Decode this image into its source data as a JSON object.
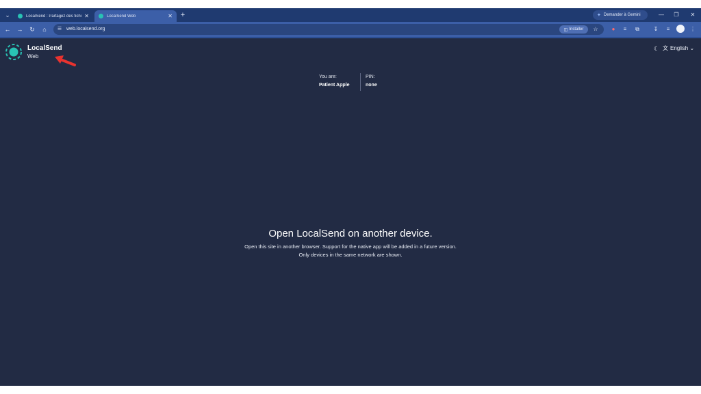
{
  "browser": {
    "tabs": [
      {
        "title": "LocalSend : Partagez des fichier",
        "active": false
      },
      {
        "title": "LocalSend Web",
        "active": true
      }
    ],
    "new_tab_icon": "plus-icon",
    "gemini_label": "Demander à Gemini",
    "window_controls": [
      "minimize-icon",
      "restore-icon",
      "close-icon"
    ],
    "url": "web.localsend.org",
    "install_label": "Installer",
    "accent_color": "#3c5fa8"
  },
  "page": {
    "brand": "LocalSend",
    "brand_sub": "Web",
    "language": "English",
    "you_are_label": "You are:",
    "device_name": "Patient Apple",
    "pin_label": "PIN:",
    "pin_value": "none",
    "headline": "Open LocalSend on another device.",
    "subtext_1": "Open this site in another browser. Support for the native app will be added in a future version.",
    "subtext_2": "Only devices in the same network are shown.",
    "background_color": "#222b44",
    "logo_color": "#29c2b4",
    "annotation_arrow_color": "#e8332f"
  }
}
